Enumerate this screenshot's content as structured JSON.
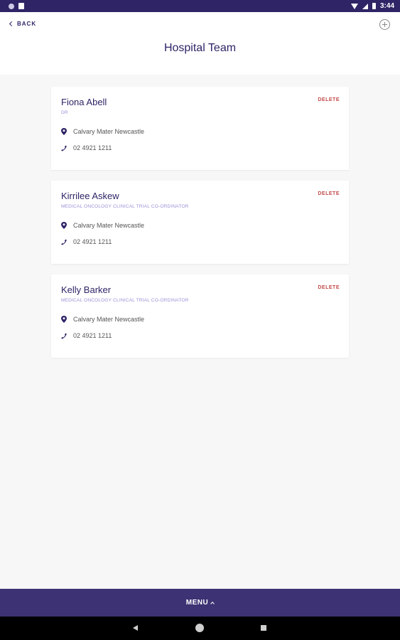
{
  "status_bar": {
    "time": "3:44",
    "icons": [
      "notification-icon",
      "sim-card-icon",
      "wifi-icon",
      "signal-icon",
      "battery-icon"
    ]
  },
  "header": {
    "back_label": "BACK",
    "title": "Hospital Team",
    "add_icon": "plus-circle-icon"
  },
  "team": [
    {
      "name": "Fiona Abell",
      "role": "DR",
      "location": "Calvary Mater Newcastle",
      "phone": "02 4921 1211",
      "delete_label": "DELETE"
    },
    {
      "name": "Kirrilee Askew",
      "role": "MEDICAL ONCOLOGY CLINICAL TRIAL CO-ORDINATOR",
      "location": "Calvary Mater Newcastle",
      "phone": "02 4921 1211",
      "delete_label": "DELETE"
    },
    {
      "name": "Kelly Barker",
      "role": "MEDICAL ONCOLOGY CLINICAL TRIAL CO-ORDINATOR",
      "location": "Calvary Mater Newcastle",
      "phone": "02 4921 1211",
      "delete_label": "DELETE"
    }
  ],
  "menu": {
    "label": "MENU"
  },
  "colors": {
    "primary": "#2e2466",
    "menu_bar": "#3d3273",
    "role_text": "#9b8fd6",
    "delete": "#c44a4a",
    "background": "#f7f7f7"
  }
}
